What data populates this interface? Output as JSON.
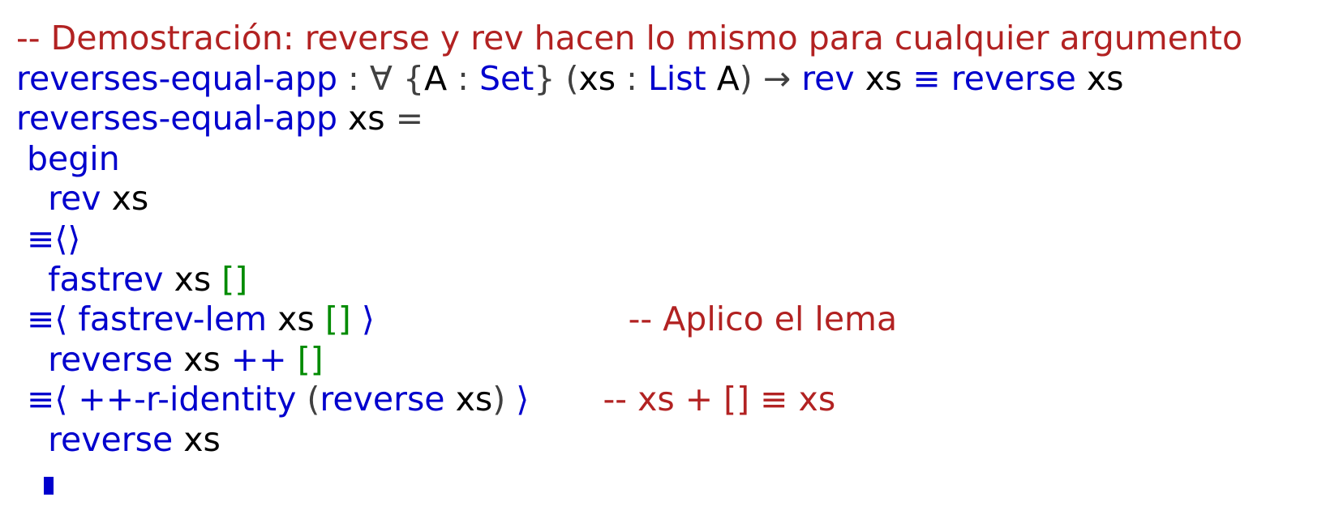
{
  "lines": [
    {
      "segs": [
        {
          "t": "-- Demostración: reverse y rev hacen lo mismo para cualquier argumento",
          "c": "cm"
        }
      ]
    },
    {
      "segs": [
        {
          "t": "reverses-equal-app",
          "c": "fn"
        },
        {
          "t": " : ",
          "c": "pu"
        },
        {
          "t": "∀",
          "c": "pu"
        },
        {
          "t": " {",
          "c": "pu"
        },
        {
          "t": "A",
          "c": "va"
        },
        {
          "t": " : ",
          "c": "pu"
        },
        {
          "t": "Set",
          "c": "ty"
        },
        {
          "t": "} (",
          "c": "pu"
        },
        {
          "t": "xs",
          "c": "va"
        },
        {
          "t": " : ",
          "c": "pu"
        },
        {
          "t": "List",
          "c": "ty"
        },
        {
          "t": " ",
          "c": "va"
        },
        {
          "t": "A",
          "c": "va"
        },
        {
          "t": ") → ",
          "c": "pu"
        },
        {
          "t": "rev",
          "c": "fn"
        },
        {
          "t": " xs ",
          "c": "va"
        },
        {
          "t": "≡",
          "c": "op"
        },
        {
          "t": " ",
          "c": "va"
        },
        {
          "t": "reverse",
          "c": "fn"
        },
        {
          "t": " xs",
          "c": "va"
        }
      ]
    },
    {
      "segs": [
        {
          "t": "reverses-equal-app",
          "c": "fn"
        },
        {
          "t": " xs ",
          "c": "va"
        },
        {
          "t": "=",
          "c": "pu"
        }
      ]
    },
    {
      "segs": [
        {
          "t": " begin",
          "c": "kw"
        }
      ]
    },
    {
      "segs": [
        {
          "t": "   rev",
          "c": "fn"
        },
        {
          "t": " xs",
          "c": "va"
        }
      ]
    },
    {
      "segs": [
        {
          "t": " ≡⟨⟩",
          "c": "op"
        }
      ]
    },
    {
      "segs": [
        {
          "t": "   fastrev",
          "c": "fn"
        },
        {
          "t": " xs ",
          "c": "va"
        },
        {
          "t": "[]",
          "c": "ctor"
        }
      ]
    },
    {
      "segs": [
        {
          "t": " ≡⟨ ",
          "c": "op"
        },
        {
          "t": "fastrev-lem",
          "c": "fn"
        },
        {
          "t": " xs ",
          "c": "va"
        },
        {
          "t": "[]",
          "c": "ctor"
        },
        {
          "t": " ⟩",
          "c": "op"
        },
        {
          "t": "                        ",
          "c": "va"
        },
        {
          "t": "-- Aplico el lema",
          "c": "cm"
        }
      ]
    },
    {
      "segs": [
        {
          "t": "   reverse",
          "c": "fn"
        },
        {
          "t": " xs ",
          "c": "va"
        },
        {
          "t": "++",
          "c": "op"
        },
        {
          "t": " ",
          "c": "va"
        },
        {
          "t": "[]",
          "c": "ctor"
        }
      ]
    },
    {
      "segs": [
        {
          "t": " ≡⟨ ",
          "c": "op"
        },
        {
          "t": "++-r-identity",
          "c": "fn"
        },
        {
          "t": " (",
          "c": "pu"
        },
        {
          "t": "reverse",
          "c": "fn"
        },
        {
          "t": " xs",
          "c": "va"
        },
        {
          "t": ")",
          "c": "pu"
        },
        {
          "t": " ⟩",
          "c": "op"
        },
        {
          "t": "       ",
          "c": "va"
        },
        {
          "t": "-- xs + [] ≡ xs",
          "c": "cm"
        }
      ]
    },
    {
      "segs": [
        {
          "t": "   reverse",
          "c": "fn"
        },
        {
          "t": " xs",
          "c": "va"
        }
      ]
    }
  ]
}
